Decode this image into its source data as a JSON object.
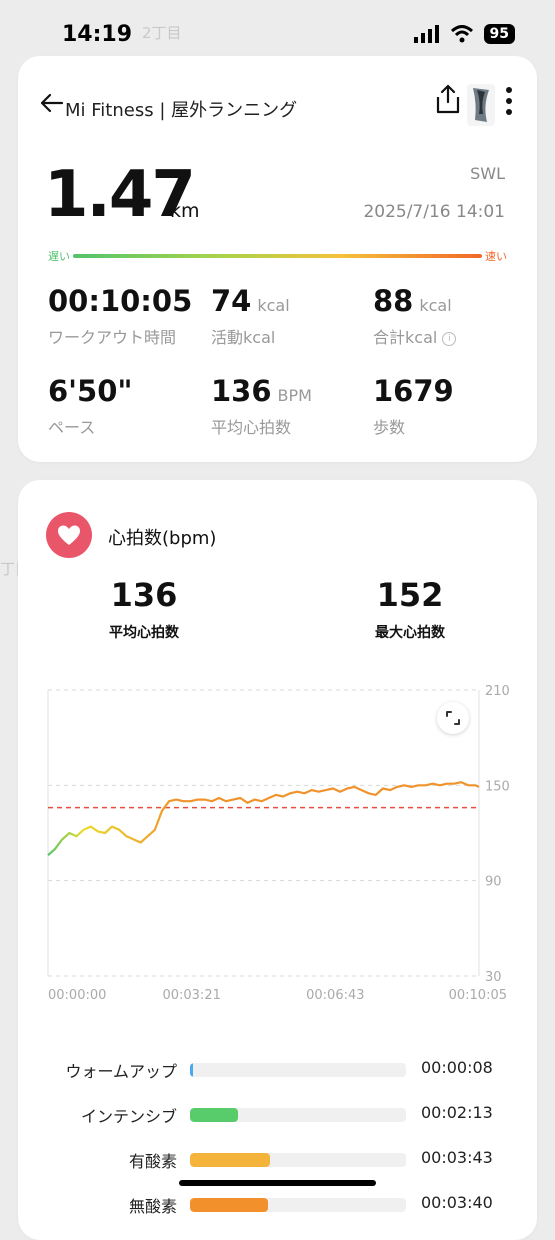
{
  "status_bar": {
    "time": "14:19",
    "battery": "95"
  },
  "map_labels": [
    "2丁目",
    "丁目"
  ],
  "header": {
    "title": "Mi Fitness | 屋外ランニング"
  },
  "summary": {
    "distance": "1.47",
    "distance_unit": "km",
    "device": "SWL",
    "datetime": "2025/7/16 14:01",
    "pace_slow_label": "遅い",
    "pace_fast_label": "速い",
    "stats": [
      {
        "value": "00:10:05",
        "unit": "",
        "label": "ワークアウト時間"
      },
      {
        "value": "74",
        "unit": "kcal",
        "label": "活動kcal"
      },
      {
        "value": "88",
        "unit": "kcal",
        "label": "合計kcal"
      },
      {
        "value": "6'50\"",
        "unit": "",
        "label": "ペース"
      },
      {
        "value": "136",
        "unit": "BPM",
        "label": "平均心拍数"
      },
      {
        "value": "1679",
        "unit": "",
        "label": "歩数"
      }
    ]
  },
  "heart_rate": {
    "title": "心拍数(bpm)",
    "avg_value": "136",
    "avg_label": "平均心拍数",
    "max_value": "152",
    "max_label": "最大心拍数"
  },
  "chart_data": {
    "type": "line",
    "ylim": [
      30,
      210
    ],
    "y_ticks": [
      "210",
      "150",
      "90",
      "30"
    ],
    "x_ticks": [
      "00:00:00",
      "00:03:21",
      "00:06:43",
      "00:10:05"
    ],
    "average_line": 136,
    "series": [
      {
        "x": [
          0,
          10,
          20,
          30,
          40,
          50,
          60,
          70,
          80,
          90,
          100,
          110,
          120,
          130,
          140,
          150,
          160,
          170,
          180,
          190,
          200,
          210,
          220,
          230,
          240,
          250,
          260,
          270,
          280,
          290,
          300,
          310,
          320,
          330,
          340,
          350,
          360,
          370,
          380,
          390,
          400,
          410,
          420,
          430,
          440,
          450,
          460,
          470,
          480,
          490,
          500,
          510,
          520,
          530,
          540,
          550,
          560,
          570,
          580,
          590,
          600,
          605
        ],
        "values": [
          106,
          110,
          116,
          120,
          118,
          122,
          124,
          121,
          120,
          124,
          122,
          118,
          116,
          114,
          118,
          122,
          134,
          140,
          141,
          140,
          140,
          141,
          141,
          140,
          142,
          140,
          141,
          142,
          139,
          141,
          140,
          142,
          144,
          143,
          145,
          146,
          145,
          147,
          146,
          147,
          148,
          146,
          148,
          149,
          147,
          145,
          144,
          148,
          147,
          149,
          150,
          149,
          150,
          150,
          151,
          150,
          151,
          151,
          152,
          150,
          150,
          149
        ]
      }
    ]
  },
  "zones": [
    {
      "label": "ウォームアップ",
      "time": "00:00:08",
      "fraction": 0.01,
      "color": "#4aa8ee"
    },
    {
      "label": "インテンシブ",
      "time": "00:02:13",
      "fraction": 0.22,
      "color": "#58cc6a"
    },
    {
      "label": "有酸素",
      "time": "00:03:43",
      "fraction": 0.37,
      "color": "#f4b43b"
    },
    {
      "label": "無酸素",
      "time": "00:03:40",
      "fraction": 0.36,
      "color": "#f2902c"
    }
  ],
  "colors": {
    "accent_red": "#e9566a",
    "hr_line_start": "#52c46b",
    "hr_line_mid": "#e8dc2e",
    "hr_line_end": "#f0932c",
    "avg_line": "#e74c3c"
  }
}
